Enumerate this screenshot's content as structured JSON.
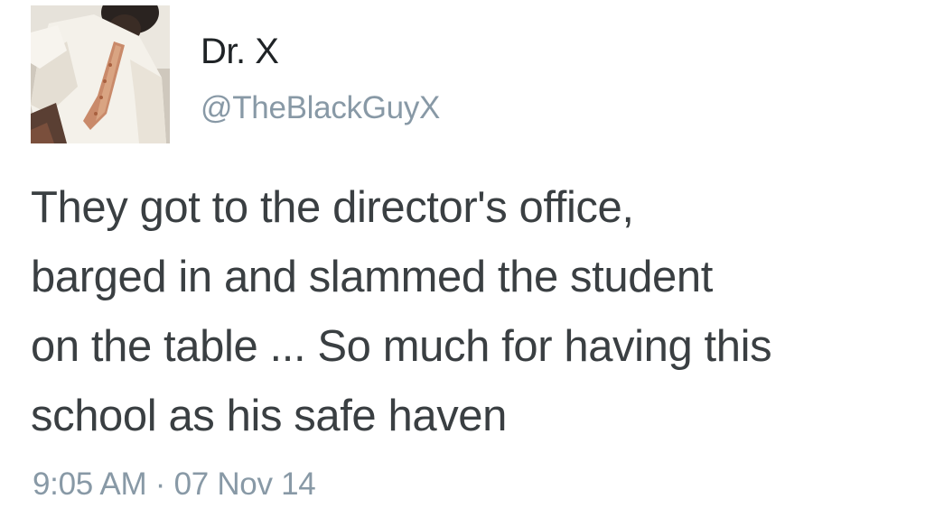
{
  "tweet": {
    "author": {
      "display_name": "Dr. X",
      "handle": "@TheBlackGuyX",
      "avatar": "profile-photo"
    },
    "text_lines": [
      "They got to the director's office,",
      "barged in and slammed the student",
      "on the table ... So much for having this",
      "school as his safe haven"
    ],
    "time": "9:05 AM",
    "separator": "·",
    "date": "07 Nov 14"
  },
  "colors": {
    "name": "#1f2326",
    "body_text": "#3a3f42",
    "muted": "#8899a6",
    "background": "#ffffff"
  }
}
